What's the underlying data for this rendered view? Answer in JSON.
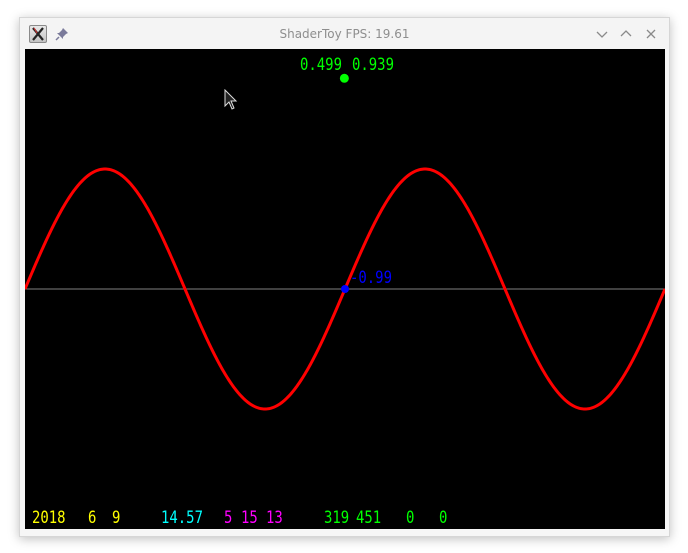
{
  "window": {
    "title": "ShaderToy FPS: 19.61",
    "app_icon": "x-logo-icon",
    "pin_icon": "pin-icon",
    "buttons": [
      {
        "name": "minimize-button",
        "icon": "chevron-down-icon"
      },
      {
        "name": "maximize-button",
        "icon": "chevron-up-icon"
      },
      {
        "name": "close-button",
        "icon": "close-icon"
      }
    ]
  },
  "overlay": {
    "mouse_x": "0.499",
    "mouse_y": "0.939",
    "value_label": "-0.99",
    "bottom": {
      "date_year": "2018",
      "date_month": "6",
      "date_day": "9",
      "time": "14.57",
      "time_h": "5",
      "time_m": "15",
      "time_s": "13",
      "pos_x": "319",
      "pos_y": "451",
      "flag_a": "0",
      "flag_b": "0"
    }
  },
  "colors": {
    "curve": "#ff0000",
    "axis": "#808080",
    "point": "#0000ff",
    "mouse_dot": "#00ff00",
    "background": "#000000"
  },
  "chart_data": {
    "type": "line",
    "function": "sine",
    "cycles": 2,
    "amplitude": 1,
    "x_range": [
      0,
      1
    ],
    "y_range": [
      -1,
      1
    ],
    "marker_x": 0.5,
    "marker_label": "-0.99",
    "grid": false
  }
}
